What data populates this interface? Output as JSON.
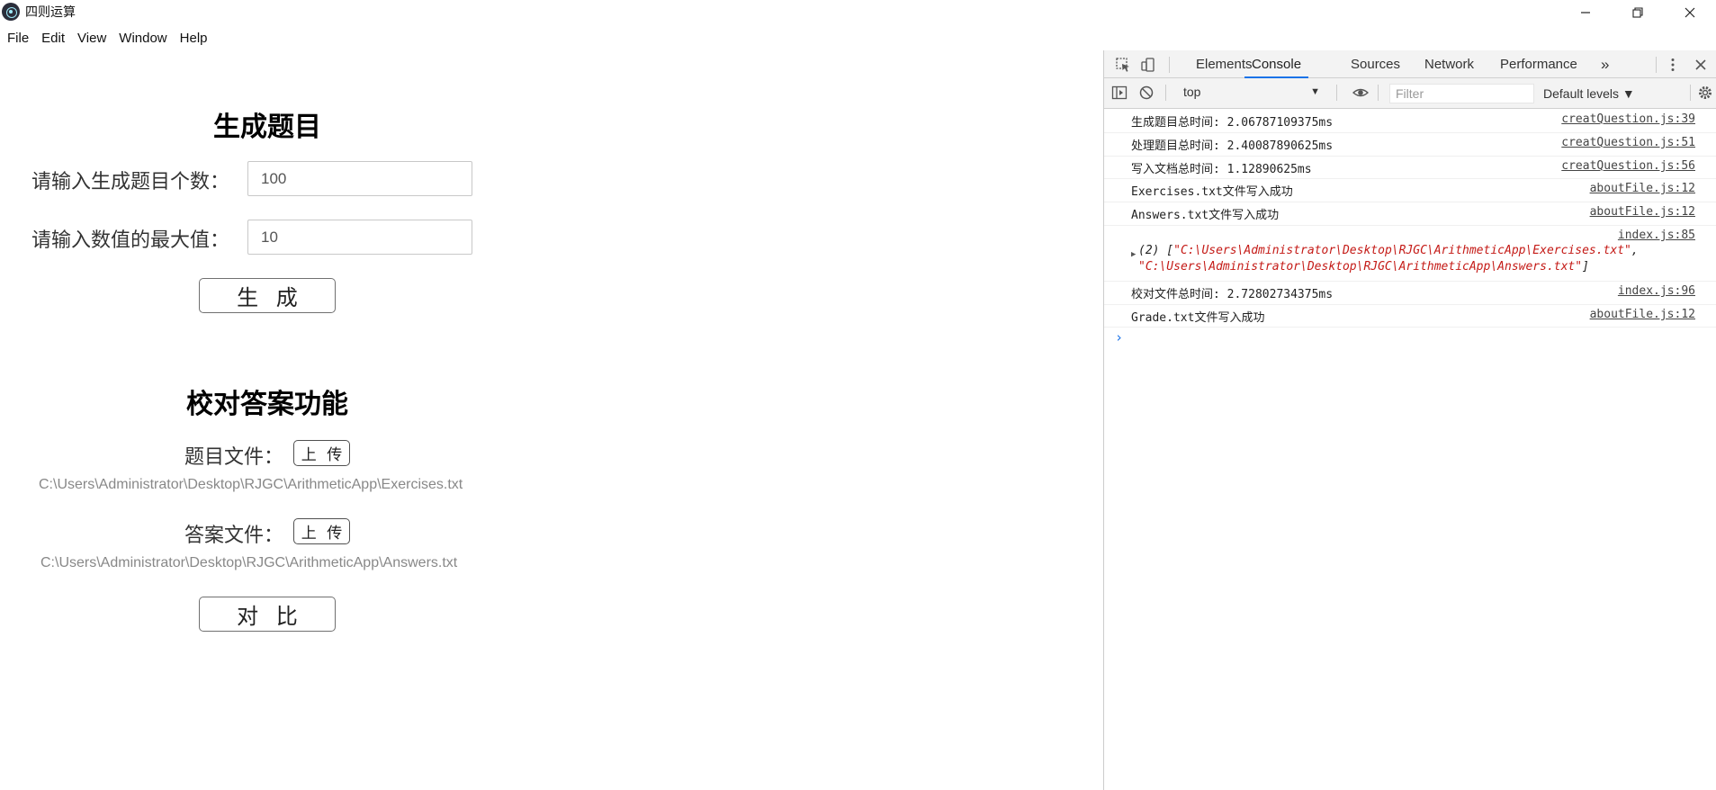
{
  "window": {
    "title": "四则运算",
    "controls": [
      "minimize-icon",
      "restore-icon",
      "close-icon"
    ]
  },
  "menu": {
    "items": [
      "File",
      "Edit",
      "View",
      "Window",
      "Help"
    ]
  },
  "generate_section": {
    "title": "生成题目",
    "count_label": "请输入生成题目个数：",
    "count_value": "100",
    "max_label": "请输入数值的最大值：",
    "max_value": "10",
    "generate_button": "生 成"
  },
  "check_section": {
    "title": "校对答案功能",
    "exercise_label": "题目文件：",
    "exercise_upload": "上 传",
    "exercise_path": "C:\\Users\\Administrator\\Desktop\\RJGC\\ArithmeticApp\\Exercises.txt",
    "answer_label": "答案文件：",
    "answer_upload": "上 传",
    "answer_path": "C:\\Users\\Administrator\\Desktop\\RJGC\\ArithmeticApp\\Answers.txt",
    "compare_button": "对 比"
  },
  "devtools": {
    "tabs": [
      "Elements",
      "Console",
      "Sources",
      "Network",
      "Performance"
    ],
    "active_tab": "Console",
    "more_tabs": "»",
    "context": "top",
    "filter_placeholder": "Filter",
    "levels": "Default levels ▼",
    "logs": [
      {
        "message": "生成题目总时间: 2.06787109375ms",
        "source": "creatQuestion.js:39"
      },
      {
        "message": "处理题目总时间: 2.40087890625ms",
        "source": "creatQuestion.js:51"
      },
      {
        "message": "写入文档总时间: 1.12890625ms",
        "source": "creatQuestion.js:56"
      },
      {
        "message": "Exercises.txt文件写入成功",
        "source": "aboutFile.js:12"
      },
      {
        "message": "Answers.txt文件写入成功",
        "source": "aboutFile.js:12"
      }
    ],
    "array_log": {
      "source": "index.js:85",
      "prefix": "(2) [",
      "item1": "\"C:\\Users\\Administrator\\Desktop\\RJGC\\ArithmeticApp\\Exercises.txt\"",
      "sep": ",",
      "item2": "\"C:\\Users\\Administrator\\Desktop\\RJGC\\ArithmeticApp\\Answers.txt\"",
      "suffix": "]"
    },
    "logs_after": [
      {
        "message": "校对文件总时间: 2.72802734375ms",
        "source": "index.js:96"
      },
      {
        "message": "Grade.txt文件写入成功",
        "source": "aboutFile.js:12"
      }
    ],
    "prompt_symbol": "›"
  }
}
